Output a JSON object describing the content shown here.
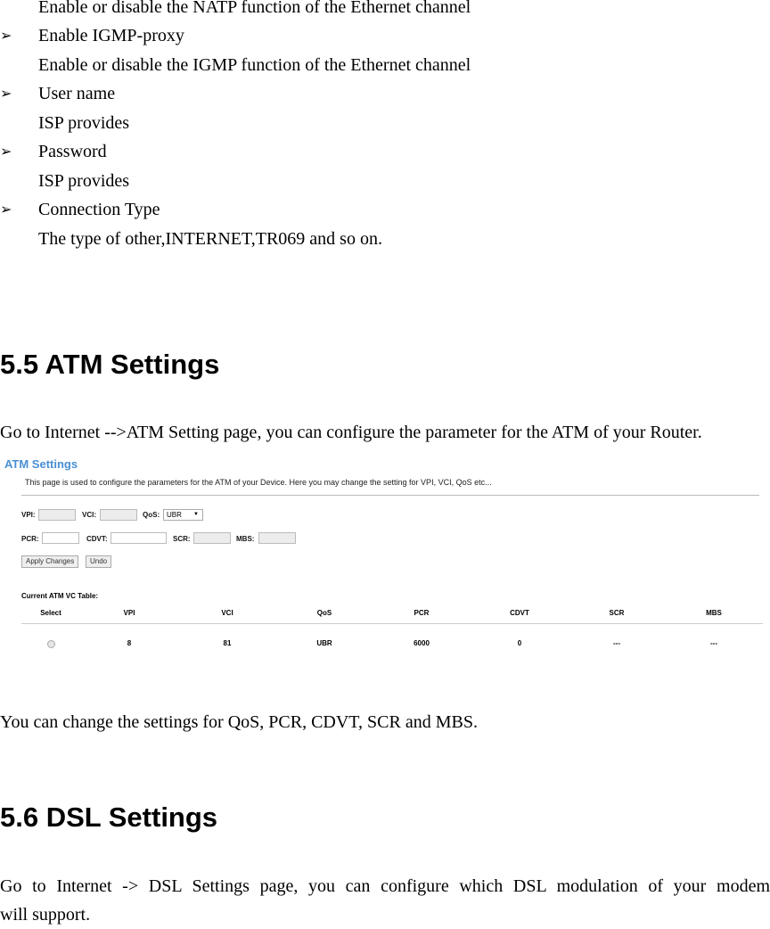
{
  "intro_list": [
    {
      "type": "desc",
      "text": "Enable or disable the NATP function of the Ethernet channel"
    },
    {
      "type": "item",
      "text": "Enable IGMP-proxy"
    },
    {
      "type": "desc",
      "text": "Enable or disable the IGMP function of the Ethernet channel"
    },
    {
      "type": "item",
      "text": "User name"
    },
    {
      "type": "desc",
      "text": "ISP provides"
    },
    {
      "type": "item",
      "text": "Password"
    },
    {
      "type": "desc",
      "text": "ISP provides"
    },
    {
      "type": "item",
      "text": "Connection Type"
    },
    {
      "type": "desc",
      "text": "The type of other,INTERNET,TR069 and so on."
    }
  ],
  "bullet_glyph": "➢",
  "section_55": {
    "heading": "5.5 ATM Settings",
    "intro": "Go to Internet -->ATM Setting page, you can configure the parameter for the ATM of your Router.",
    "after": "You can change the settings for QoS, PCR, CDVT, SCR and MBS."
  },
  "atm_screenshot": {
    "title": "ATM Settings",
    "description": "This page is used to configure the parameters for the ATM of your Device. Here you may change the setting for VPI, VCI, QoS etc...",
    "fields": {
      "vpi_label": "VPI:",
      "vpi_value": "",
      "vci_label": "VCI:",
      "vci_value": "",
      "qos_label": "QoS:",
      "qos_value": "UBR",
      "pcr_label": "PCR:",
      "pcr_value": "",
      "cdvt_label": "CDVT:",
      "cdvt_value": "",
      "scr_label": "SCR:",
      "scr_value": "",
      "mbs_label": "MBS:",
      "mbs_value": ""
    },
    "buttons": {
      "apply": "Apply Changes",
      "undo": "Undo"
    },
    "table_title": "Current ATM VC Table:",
    "columns": [
      "Select",
      "VPI",
      "VCI",
      "QoS",
      "PCR",
      "CDVT",
      "SCR",
      "MBS"
    ],
    "rows": [
      {
        "vpi": "8",
        "vci": "81",
        "qos": "UBR",
        "pcr": "6000",
        "cdvt": "0",
        "scr": "---",
        "mbs": "---"
      }
    ]
  },
  "section_56": {
    "heading": "5.6 DSL Settings",
    "intro_line1": "Go to Internet -> DSL Settings page, you can configure which DSL modulation of your modem",
    "intro_line2": "will support."
  }
}
